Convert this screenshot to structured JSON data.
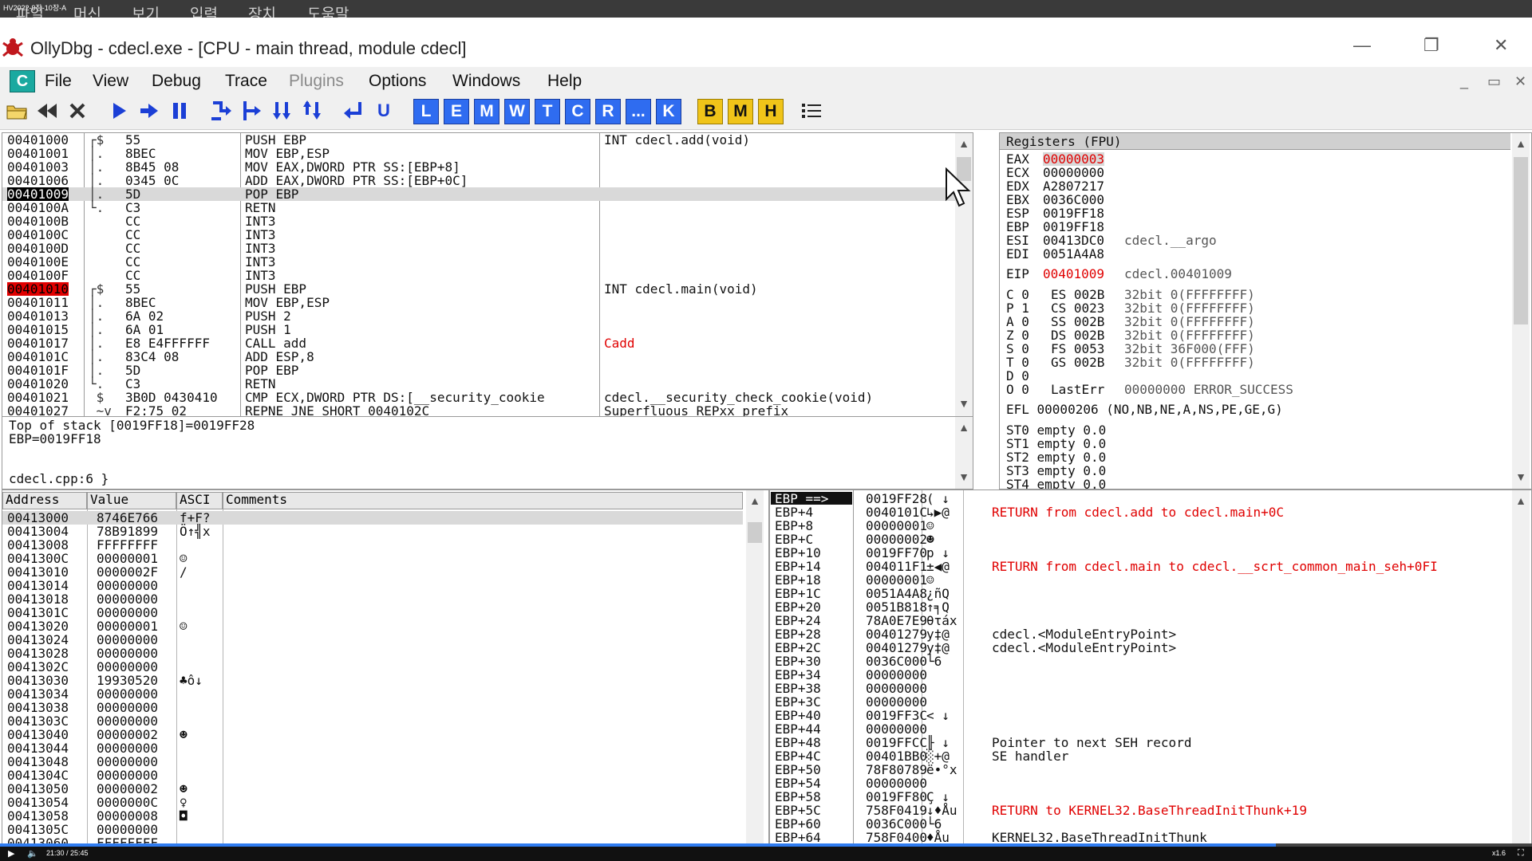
{
  "vm": {
    "tag": "HV2022-9장-10장-A",
    "menu": [
      "파일",
      "머신",
      "보기",
      "입력",
      "장치",
      "도움말"
    ]
  },
  "window": {
    "title": "OllyDbg - cdecl.exe - [CPU - main thread, module cdecl]",
    "minimize": "—",
    "restore": "❐",
    "close": "✕"
  },
  "menu": {
    "badge": "C",
    "items": [
      "File",
      "View",
      "Debug",
      "Trace",
      "Plugins",
      "Options",
      "Windows",
      "Help"
    ],
    "mdi": [
      "_",
      "▭",
      "✕"
    ]
  },
  "toolbar": {
    "media": [
      "open-icon",
      "rewind-icon",
      "close-icon",
      "run-icon",
      "step-icon",
      "pause-icon",
      "step-into-icon",
      "step-over-icon",
      "trace-into-icon",
      "trace-over-icon",
      "execute-till-return-icon",
      "execute-till-user-icon"
    ],
    "letters_blue": [
      "L",
      "E",
      "M",
      "W",
      "T",
      "C",
      "R",
      "...",
      "K"
    ],
    "letters_yellow": [
      "B",
      "M",
      "H"
    ]
  },
  "disasm": {
    "rows": [
      {
        "addr": "00401000",
        "bracket": "┌$",
        "hex": "55",
        "cmd": "PUSH EBP",
        "comment": "INT cdecl.add(void)"
      },
      {
        "addr": "00401001",
        "bracket": "│.",
        "hex": "8BEC",
        "cmd": "MOV EBP,ESP",
        "comment": ""
      },
      {
        "addr": "00401003",
        "bracket": "│.",
        "hex": "8B45 08",
        "cmd": "MOV EAX,DWORD PTR SS:[EBP+8]",
        "comment": ""
      },
      {
        "addr": "00401006",
        "bracket": "│.",
        "hex": "0345 0C",
        "cmd": "ADD EAX,DWORD PTR SS:[EBP+0C]",
        "comment": ""
      },
      {
        "addr": "00401009",
        "bracket": "│.",
        "hex": "5D",
        "cmd": "POP EBP",
        "comment": ""
      },
      {
        "addr": "0040100A",
        "bracket": "└.",
        "hex": "C3",
        "cmd": "RETN",
        "comment": ""
      },
      {
        "addr": "0040100B",
        "bracket": "",
        "hex": "CC",
        "cmd": "INT3",
        "comment": ""
      },
      {
        "addr": "0040100C",
        "bracket": "",
        "hex": "CC",
        "cmd": "INT3",
        "comment": ""
      },
      {
        "addr": "0040100D",
        "bracket": "",
        "hex": "CC",
        "cmd": "INT3",
        "comment": ""
      },
      {
        "addr": "0040100E",
        "bracket": "",
        "hex": "CC",
        "cmd": "INT3",
        "comment": ""
      },
      {
        "addr": "0040100F",
        "bracket": "",
        "hex": "CC",
        "cmd": "INT3",
        "comment": ""
      },
      {
        "addr": "00401010",
        "bracket": "┌$",
        "hex": "55",
        "cmd": "PUSH EBP",
        "comment": "INT cdecl.main(void)"
      },
      {
        "addr": "00401011",
        "bracket": "│.",
        "hex": "8BEC",
        "cmd": "MOV EBP,ESP",
        "comment": ""
      },
      {
        "addr": "00401013",
        "bracket": "│.",
        "hex": "6A 02",
        "cmd": "PUSH 2",
        "comment": ""
      },
      {
        "addr": "00401015",
        "bracket": "│.",
        "hex": "6A 01",
        "cmd": "PUSH 1",
        "comment": ""
      },
      {
        "addr": "00401017",
        "bracket": "│.",
        "hex": "E8 E4FFFFFF",
        "cmd": "CALL add",
        "comment": "Cadd"
      },
      {
        "addr": "0040101C",
        "bracket": "│.",
        "hex": "83C4 08",
        "cmd": "ADD ESP,8",
        "comment": ""
      },
      {
        "addr": "0040101F",
        "bracket": "│.",
        "hex": "5D",
        "cmd": "POP EBP",
        "comment": ""
      },
      {
        "addr": "00401020",
        "bracket": "└.",
        "hex": "C3",
        "cmd": "RETN",
        "comment": ""
      },
      {
        "addr": "00401021",
        "bracket": " $",
        "hex": "3B0D 0430410",
        "cmd": "CMP ECX,DWORD PTR DS:[__security_cookie",
        "comment": "cdecl.__security_check_cookie(void)"
      },
      {
        "addr": "00401027",
        "bracket": " ~v",
        "hex": "F2:75 02",
        "cmd": "REPNE JNE SHORT 0040102C",
        "comment": "Superfluous REPxx prefix"
      }
    ]
  },
  "info": {
    "line1": "Top of stack [0019FF18]=0019FF28",
    "line2": "EBP=0019FF18",
    "line3": "cdecl.cpp:6 }"
  },
  "registers": {
    "header": "Registers (FPU)",
    "gpr": [
      {
        "name": "EAX",
        "value": "00000003",
        "note": ""
      },
      {
        "name": "ECX",
        "value": "00000000",
        "note": ""
      },
      {
        "name": "EDX",
        "value": "A2807217",
        "note": ""
      },
      {
        "name": "EBX",
        "value": "0036C000",
        "note": ""
      },
      {
        "name": "ESP",
        "value": "0019FF18",
        "note": ""
      },
      {
        "name": "EBP",
        "value": "0019FF18",
        "note": ""
      },
      {
        "name": "ESI",
        "value": "00413DC0",
        "note": "cdecl.__argo"
      },
      {
        "name": "EDI",
        "value": "0051A4A8",
        "note": ""
      }
    ],
    "eip": {
      "name": "EIP",
      "value": "00401009",
      "note": "cdecl.00401009"
    },
    "flags": [
      {
        "f": "C 0",
        "seg": "ES 002B",
        "desc": "32bit 0(FFFFFFFF)"
      },
      {
        "f": "P 1",
        "seg": "CS 0023",
        "desc": "32bit 0(FFFFFFFF)"
      },
      {
        "f": "A 0",
        "seg": "SS 002B",
        "desc": "32bit 0(FFFFFFFF)"
      },
      {
        "f": "Z 0",
        "seg": "DS 002B",
        "desc": "32bit 0(FFFFFFFF)"
      },
      {
        "f": "S 0",
        "seg": "FS 0053",
        "desc": "32bit 36F000(FFF)"
      },
      {
        "f": "T 0",
        "seg": "GS 002B",
        "desc": "32bit 0(FFFFFFFF)"
      },
      {
        "f": "D 0",
        "seg": "",
        "desc": ""
      },
      {
        "f": "O 0",
        "seg": "LastErr",
        "desc": "00000000 ERROR_SUCCESS"
      }
    ],
    "efl": "EFL 00000206 (NO,NB,NE,A,NS,PE,GE,G)",
    "fpu": [
      "ST0 empty 0.0",
      "ST1 empty 0.0",
      "ST2 empty 0.0",
      "ST3 empty 0.0",
      "ST4 empty 0.0"
    ]
  },
  "dump": {
    "headers": [
      "Address",
      "Value",
      "ASCI",
      "Comments"
    ],
    "rows": [
      {
        "addr": "00413000",
        "val": "8746E766",
        "ascii": "f+F?"
      },
      {
        "addr": "00413004",
        "val": "78B91899",
        "ascii": "Ö↑╣x"
      },
      {
        "addr": "00413008",
        "val": "FFFFFFFF",
        "ascii": ""
      },
      {
        "addr": "0041300C",
        "val": "00000001",
        "ascii": "☺"
      },
      {
        "addr": "00413010",
        "val": "0000002F",
        "ascii": "/"
      },
      {
        "addr": "00413014",
        "val": "00000000",
        "ascii": ""
      },
      {
        "addr": "00413018",
        "val": "00000000",
        "ascii": ""
      },
      {
        "addr": "0041301C",
        "val": "00000000",
        "ascii": ""
      },
      {
        "addr": "00413020",
        "val": "00000001",
        "ascii": "☺"
      },
      {
        "addr": "00413024",
        "val": "00000000",
        "ascii": ""
      },
      {
        "addr": "00413028",
        "val": "00000000",
        "ascii": ""
      },
      {
        "addr": "0041302C",
        "val": "00000000",
        "ascii": ""
      },
      {
        "addr": "00413030",
        "val": "19930520",
        "ascii": "♣ô↓"
      },
      {
        "addr": "00413034",
        "val": "00000000",
        "ascii": ""
      },
      {
        "addr": "00413038",
        "val": "00000000",
        "ascii": ""
      },
      {
        "addr": "0041303C",
        "val": "00000000",
        "ascii": ""
      },
      {
        "addr": "00413040",
        "val": "00000002",
        "ascii": "☻"
      },
      {
        "addr": "00413044",
        "val": "00000000",
        "ascii": ""
      },
      {
        "addr": "00413048",
        "val": "00000000",
        "ascii": ""
      },
      {
        "addr": "0041304C",
        "val": "00000000",
        "ascii": ""
      },
      {
        "addr": "00413050",
        "val": "00000002",
        "ascii": "☻"
      },
      {
        "addr": "00413054",
        "val": "0000000C",
        "ascii": "♀"
      },
      {
        "addr": "00413058",
        "val": "00000008",
        "ascii": "◘"
      },
      {
        "addr": "0041305C",
        "val": "00000000",
        "ascii": ""
      },
      {
        "addr": "00413060",
        "val": "FFFFFFFF",
        "ascii": ""
      }
    ]
  },
  "stack": {
    "header": "EBP ==>",
    "rows": [
      {
        "off": "EBP ==>",
        "val": "0019FF28",
        "ascii": "( ↓",
        "comment": "",
        "red": false
      },
      {
        "off": "EBP+4",
        "val": "0040101C",
        "ascii": "↳▶@",
        "comment": "RETURN from cdecl.add to cdecl.main+0C",
        "red": true
      },
      {
        "off": "EBP+8",
        "val": "00000001",
        "ascii": "☺",
        "comment": "",
        "red": false
      },
      {
        "off": "EBP+C",
        "val": "00000002",
        "ascii": "☻",
        "comment": "",
        "red": false
      },
      {
        "off": "EBP+10",
        "val": "0019FF70",
        "ascii": "p ↓",
        "comment": "",
        "red": false
      },
      {
        "off": "EBP+14",
        "val": "004011F1",
        "ascii": "±◀@",
        "comment": "RETURN from cdecl.main to cdecl.__scrt_common_main_seh+0FI",
        "red": true
      },
      {
        "off": "EBP+18",
        "val": "00000001",
        "ascii": "☺",
        "comment": "",
        "red": false
      },
      {
        "off": "EBP+1C",
        "val": "0051A4A8",
        "ascii": "¿ñQ",
        "comment": "",
        "red": false
      },
      {
        "off": "EBP+20",
        "val": "0051B818",
        "ascii": "↑╕Q",
        "comment": "",
        "red": false
      },
      {
        "off": "EBP+24",
        "val": "78A0E7E9",
        "ascii": "θτáx",
        "comment": "",
        "red": false
      },
      {
        "off": "EBP+28",
        "val": "00401279",
        "ascii": "y‡@",
        "comment": "cdecl.<ModuleEntryPoint>",
        "red": false
      },
      {
        "off": "EBP+2C",
        "val": "00401279",
        "ascii": "y‡@",
        "comment": "cdecl.<ModuleEntryPoint>",
        "red": false
      },
      {
        "off": "EBP+30",
        "val": "0036C000",
        "ascii": "└6",
        "comment": "",
        "red": false
      },
      {
        "off": "EBP+34",
        "val": "00000000",
        "ascii": "",
        "comment": "",
        "red": false
      },
      {
        "off": "EBP+38",
        "val": "00000000",
        "ascii": "",
        "comment": "",
        "red": false
      },
      {
        "off": "EBP+3C",
        "val": "00000000",
        "ascii": "",
        "comment": "",
        "red": false
      },
      {
        "off": "EBP+40",
        "val": "0019FF3C",
        "ascii": "< ↓",
        "comment": "",
        "red": false
      },
      {
        "off": "EBP+44",
        "val": "00000000",
        "ascii": "",
        "comment": "",
        "red": false
      },
      {
        "off": "EBP+48",
        "val": "0019FFCC",
        "ascii": "╟ ↓",
        "comment": "Pointer to next SEH record",
        "red": false
      },
      {
        "off": "EBP+4C",
        "val": "00401BB0",
        "ascii": "░+@",
        "comment": "SE handler",
        "red": false
      },
      {
        "off": "EBP+50",
        "val": "78F80789",
        "ascii": "ë•°x",
        "comment": "",
        "red": false
      },
      {
        "off": "EBP+54",
        "val": "00000000",
        "ascii": "",
        "comment": "",
        "red": false
      },
      {
        "off": "EBP+58",
        "val": "0019FF80",
        "ascii": "Ç ↓",
        "comment": "",
        "red": false
      },
      {
        "off": "EBP+5C",
        "val": "758F0419",
        "ascii": "↓♦Åu",
        "comment": "RETURN to KERNEL32.BaseThreadInitThunk+19",
        "red": true
      },
      {
        "off": "EBP+60",
        "val": "0036C000",
        "ascii": "└6",
        "comment": "",
        "red": false
      },
      {
        "off": "EBP+64",
        "val": "758F0400",
        "ascii": "♦Åu",
        "comment": "KERNEL32.BaseThreadInitThunk",
        "red": false
      }
    ]
  },
  "player": {
    "time": "21:30 / 25:45",
    "speed": "x1.6",
    "progress": 0.833
  }
}
